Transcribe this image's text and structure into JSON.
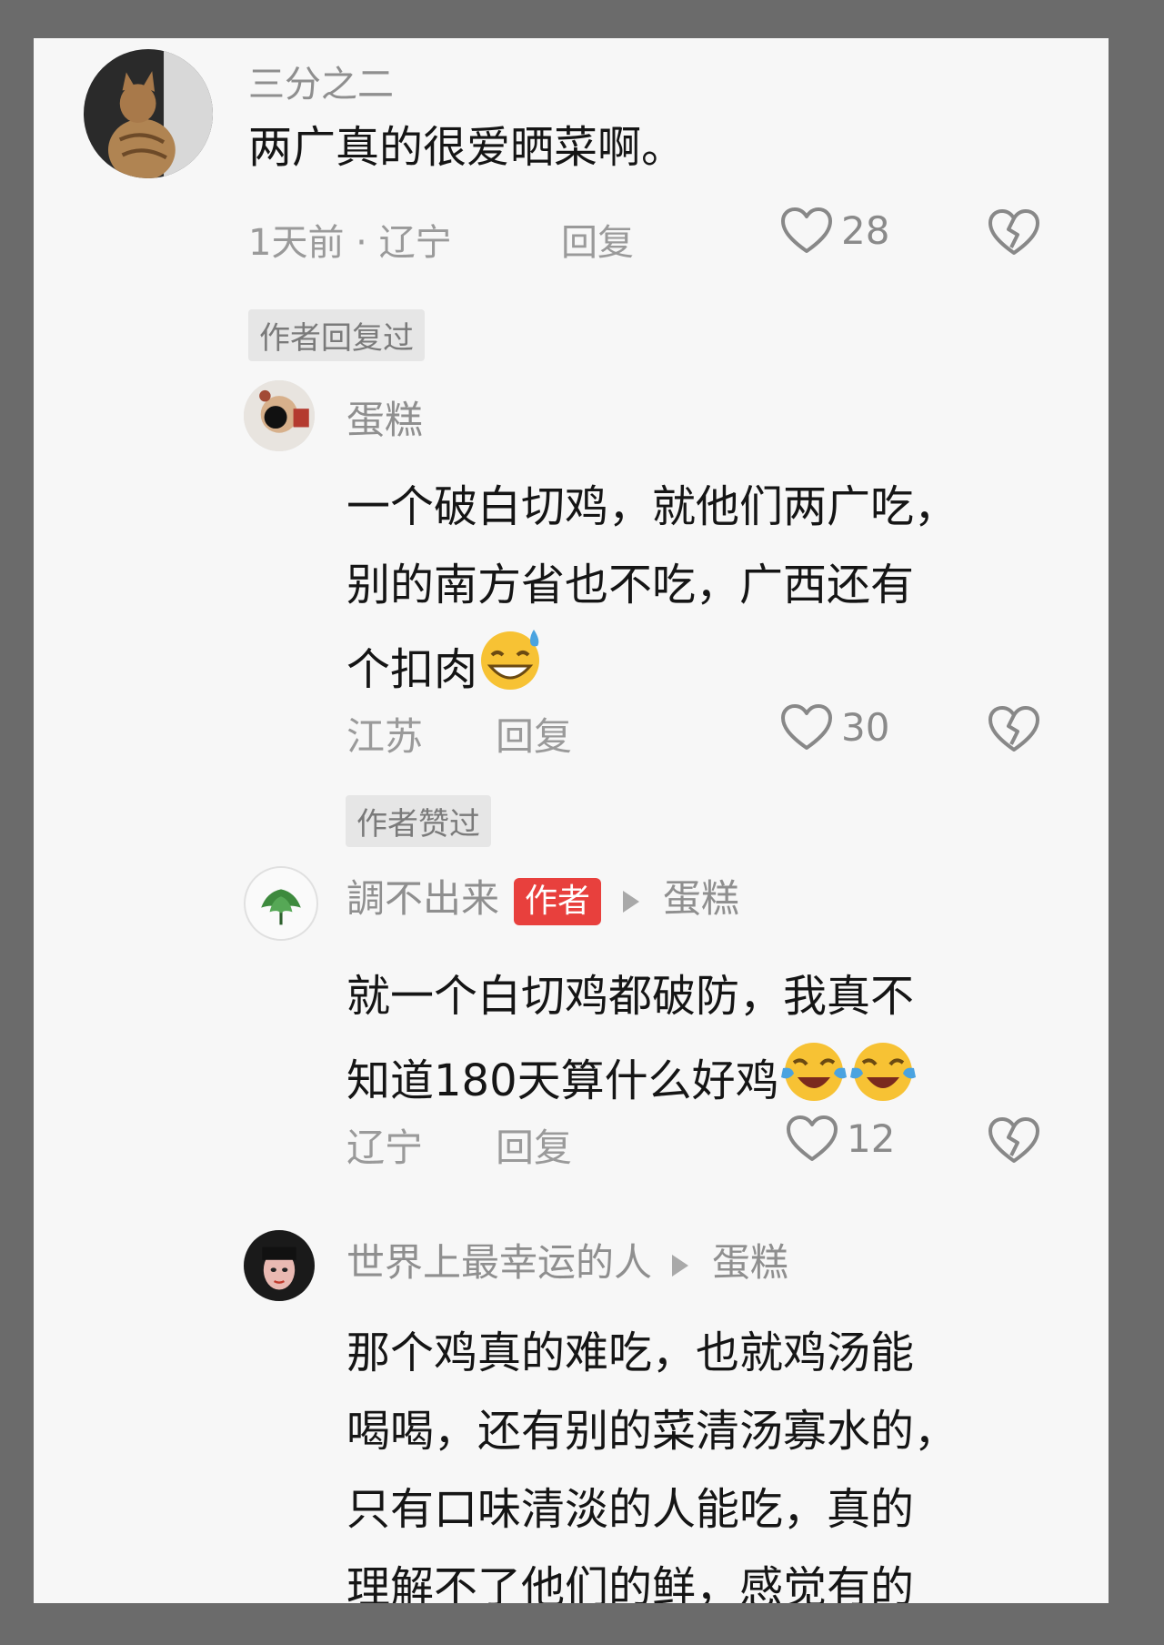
{
  "comments": [
    {
      "user": "三分之二",
      "text": "两广真的很爱晒菜啊。",
      "meta": "1天前 · 辽宁",
      "reply": "回复",
      "likes": "28",
      "badge": "作者回复过"
    },
    {
      "user": "蛋糕",
      "text_lines": [
        "一个破白切鸡，就他们两广吃，",
        "别的南方省也不吃，广西还有",
        "个扣肉"
      ],
      "meta": "江苏",
      "reply": "回复",
      "likes": "30",
      "badge": "作者赞过"
    },
    {
      "user": "調不出来",
      "author_tag": "作者",
      "reply_to": "蛋糕",
      "text_lines": [
        "就一个白切鸡都破防，我真不",
        "知道180天算什么好鸡"
      ],
      "meta": "辽宁",
      "reply": "回复",
      "likes": "12"
    },
    {
      "user": "世界上最幸运的人",
      "reply_to": "蛋糕",
      "text_lines": [
        "那个鸡真的难吃，也就鸡汤能",
        "喝喝，还有别的菜清汤寡水的，",
        "只有口味清淡的人能吃，真的",
        "理解不了他们的鲜，感觉有的"
      ]
    }
  ],
  "colors": {
    "text": "#151515",
    "muted": "#9a9a9a",
    "author_tag": "#e8403d",
    "card_bg": "#f7f7f7",
    "frame_bg": "#6b6b6b"
  },
  "icons": [
    "like-heart-icon",
    "dislike-broken-heart-icon",
    "reply-arrow-icon",
    "sweat-smile-emoji",
    "crying-laugh-emoji"
  ]
}
